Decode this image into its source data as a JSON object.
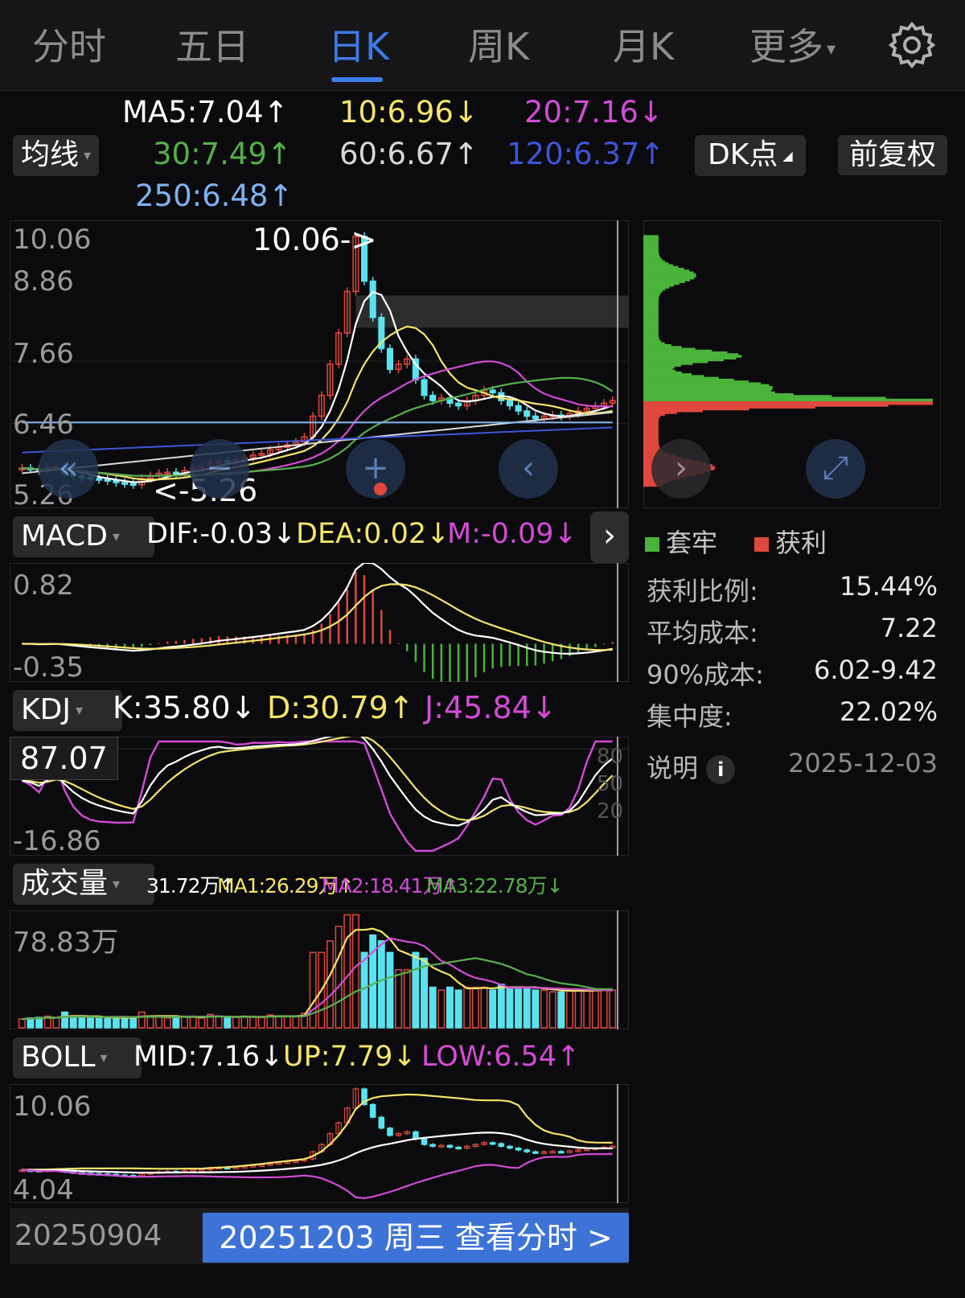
{
  "tabs": [
    "分时",
    "五日",
    "日K",
    "周K",
    "月K",
    "更多"
  ],
  "active_tab": "日K",
  "ma": {
    "ma5": "MA5:7.04↑",
    "ma10": "10:6.96↓",
    "ma20": "20:7.16↓",
    "ma30": "30:7.49↑",
    "ma60": "60:6.67↑",
    "ma120": "120:6.37↑",
    "ma250": "250:6.48↑"
  },
  "buttons": {
    "junxian": "均线",
    "dk": "DK点",
    "fuquan": "前复权"
  },
  "price_axis": [
    "10.06",
    "8.86",
    "7.66",
    "6.46",
    "5.26"
  ],
  "price_high_label": "10.06->",
  "price_low_label": "<-5.26",
  "chip_legend": {
    "trapped": "套牢",
    "profit": "获利"
  },
  "chip_stats": [
    {
      "k": "获利比例:",
      "v": "15.44%"
    },
    {
      "k": "平均成本:",
      "v": "7.22"
    },
    {
      "k": "90%成本:",
      "v": "6.02-9.42"
    },
    {
      "k": "集中度:",
      "v": "22.02%"
    }
  ],
  "explain": {
    "label": "说明",
    "date": "2025-12-03"
  },
  "macd": {
    "name": "MACD",
    "dif": "DIF:-0.03↓",
    "dea": "DEA:0.02↓",
    "m": "M:-0.09↓",
    "top": "0.82",
    "bottom": "-0.35"
  },
  "kdj": {
    "name": "KDJ",
    "k": "K:35.80↓",
    "d": "D:30.79↑",
    "j": "J:45.84↓",
    "top": "87.07",
    "bottom": "-16.86",
    "r80": "80",
    "r50": "50",
    "r20": "20"
  },
  "volume": {
    "name": "成交量",
    "v": "31.72万↑",
    "ma1": "MA1:26.29万↑",
    "ma2": "MA2:18.41万↑",
    "ma3": "MA3:22.78万↓",
    "top": "78.83万"
  },
  "boll": {
    "name": "BOLL",
    "mid": "MID:7.16↓",
    "up": "UP:7.79↓",
    "low": "LOW:6.54↑",
    "top": "10.06",
    "bottom": "4.04"
  },
  "footer": {
    "start_date": "20250904",
    "current": "20251203 周三 查看分时 >"
  },
  "colors": {
    "up": "#e0483e",
    "down": "#5ae3ee",
    "ma5": "#ffffff",
    "ma10": "#f5e56b",
    "ma20": "#d34bd6",
    "ma30": "#55b04a",
    "ma60": "#d8d8d8",
    "ma120": "#3d55d8",
    "ma250": "#7fb2f0",
    "accent": "#3d7bea",
    "trapped": "#4ab33a",
    "profit": "#e0483e"
  },
  "chart_data": {
    "type": "candlestick",
    "price_range": [
      5.26,
      10.06
    ],
    "close": [
      5.6,
      5.58,
      5.55,
      5.6,
      5.62,
      5.5,
      5.45,
      5.42,
      5.4,
      5.38,
      5.36,
      5.32,
      5.3,
      5.28,
      5.4,
      5.45,
      5.5,
      5.52,
      5.5,
      5.55,
      5.6,
      5.62,
      5.7,
      5.74,
      5.72,
      5.75,
      5.8,
      5.85,
      5.88,
      5.95,
      6.0,
      6.05,
      6.1,
      6.2,
      6.6,
      7.0,
      7.6,
      8.2,
      9.0,
      10.06,
      9.2,
      8.5,
      7.9,
      7.5,
      7.6,
      7.7,
      7.3,
      7.0,
      6.9,
      6.95,
      6.85,
      6.8,
      6.9,
      7.0,
      7.1,
      7.05,
      6.9,
      6.8,
      6.7,
      6.6,
      6.55,
      6.6,
      6.62,
      6.6,
      6.65,
      6.7,
      6.75,
      6.8,
      6.85,
      6.9
    ]
  }
}
